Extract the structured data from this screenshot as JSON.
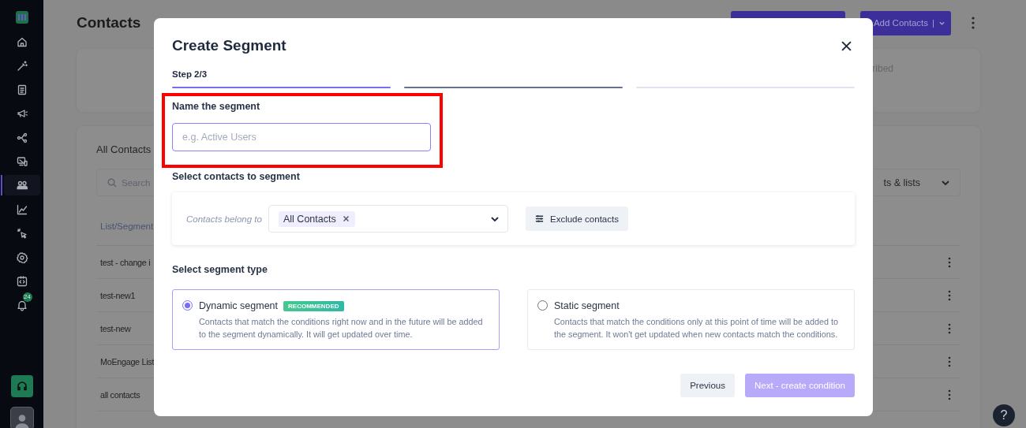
{
  "sidebar": {
    "items": [
      {
        "selected": false
      },
      {
        "selected": false
      },
      {
        "selected": false
      },
      {
        "selected": false
      },
      {
        "selected": false
      },
      {
        "selected": false
      },
      {
        "selected": true
      },
      {
        "selected": false
      },
      {
        "selected": false
      },
      {
        "selected": false
      },
      {
        "selected": false
      },
      {
        "selected": false,
        "badge": "24"
      }
    ]
  },
  "page": {
    "title": "Contacts",
    "add_button": "Add Contacts",
    "add_separator": "|",
    "summary_text": "ribed",
    "list_card": {
      "title": "All Contacts",
      "search_placeholder": "Search",
      "filter_value": "ts & lists",
      "column_1": "List/Segment",
      "rows": [
        "test - change i",
        "test-new1",
        "test-new",
        "MoEngage List",
        "all contacts"
      ]
    }
  },
  "help_button": "?",
  "modal": {
    "title": "Create Segment",
    "step_label": "Step 2/3",
    "steps": [
      {
        "complete": true,
        "selected": false
      },
      {
        "complete": false,
        "selected": true
      },
      {
        "complete": false,
        "selected": false
      }
    ],
    "name_field": {
      "label": "Name the segment",
      "placeholder": "e.g. Active Users",
      "highlighted": true
    },
    "contacts_section": {
      "title": "Select contacts to segment",
      "belong_label": "Contacts belong to",
      "chips": [
        "All Contacts"
      ],
      "exclude_button": "Exclude contacts"
    },
    "type_section": {
      "title": "Select segment type",
      "options": [
        {
          "label": "Dynamic segment",
          "badge": "RECOMMENDED",
          "description": "Contacts that match the conditions right now and in the future will be added to the segment dynamically. It will get updated over time.",
          "selected": true
        },
        {
          "label": "Static segment",
          "description": "Contacts that match the conditions only at this point of time will be added to the segment. It won't get updated when new contacts match the conditions.",
          "selected": false
        }
      ]
    },
    "buttons": [
      {
        "label": "Previous",
        "kind": "secondary",
        "disabled": false
      },
      {
        "label": "Next - create condition",
        "kind": "primary",
        "disabled": true
      }
    ]
  }
}
